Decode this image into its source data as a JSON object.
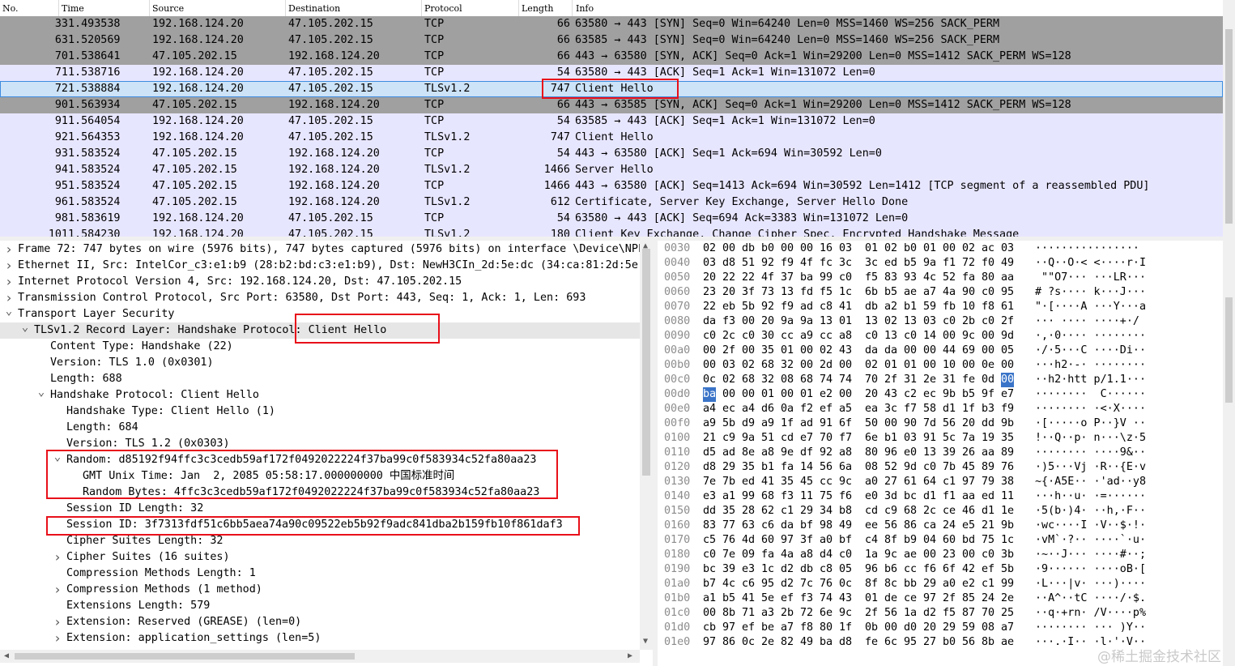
{
  "columns": {
    "no": "No.",
    "time": "Time",
    "source": "Source",
    "destination": "Destination",
    "protocol": "Protocol",
    "length": "Length",
    "info": "Info"
  },
  "packets": [
    {
      "no": "33",
      "time": "1.493538",
      "src": "192.168.124.20",
      "dst": "47.105.202.15",
      "proto": "TCP",
      "len": "66",
      "info": "63580 → 443 [SYN] Seq=0 Win=64240 Len=0 MSS=1460 WS=256 SACK_PERM",
      "bg": "#a0a0a0"
    },
    {
      "no": "63",
      "time": "1.520569",
      "src": "192.168.124.20",
      "dst": "47.105.202.15",
      "proto": "TCP",
      "len": "66",
      "info": "63585 → 443 [SYN] Seq=0 Win=64240 Len=0 MSS=1460 WS=256 SACK_PERM",
      "bg": "#a0a0a0"
    },
    {
      "no": "70",
      "time": "1.538641",
      "src": "47.105.202.15",
      "dst": "192.168.124.20",
      "proto": "TCP",
      "len": "66",
      "info": "443 → 63580 [SYN, ACK] Seq=0 Ack=1 Win=29200 Len=0 MSS=1412 SACK_PERM WS=128",
      "bg": "#a0a0a0"
    },
    {
      "no": "71",
      "time": "1.538716",
      "src": "192.168.124.20",
      "dst": "47.105.202.15",
      "proto": "TCP",
      "len": "54",
      "info": "63580 → 443 [ACK] Seq=1 Ack=1 Win=131072 Len=0",
      "bg": "#e7e6ff"
    },
    {
      "no": "72",
      "time": "1.538884",
      "src": "192.168.124.20",
      "dst": "47.105.202.15",
      "proto": "TLSv1.2",
      "len": "747",
      "info": "Client Hello",
      "bg": "#cde3f7",
      "selected": true
    },
    {
      "no": "90",
      "time": "1.563934",
      "src": "47.105.202.15",
      "dst": "192.168.124.20",
      "proto": "TCP",
      "len": "66",
      "info": "443 → 63585 [SYN, ACK] Seq=0 Ack=1 Win=29200 Len=0 MSS=1412 SACK_PERM WS=128",
      "bg": "#a0a0a0"
    },
    {
      "no": "91",
      "time": "1.564054",
      "src": "192.168.124.20",
      "dst": "47.105.202.15",
      "proto": "TCP",
      "len": "54",
      "info": "63585 → 443 [ACK] Seq=1 Ack=1 Win=131072 Len=0",
      "bg": "#e7e6ff"
    },
    {
      "no": "92",
      "time": "1.564353",
      "src": "192.168.124.20",
      "dst": "47.105.202.15",
      "proto": "TLSv1.2",
      "len": "747",
      "info": "Client Hello",
      "bg": "#e7e6ff"
    },
    {
      "no": "93",
      "time": "1.583524",
      "src": "47.105.202.15",
      "dst": "192.168.124.20",
      "proto": "TCP",
      "len": "54",
      "info": "443 → 63580 [ACK] Seq=1 Ack=694 Win=30592 Len=0",
      "bg": "#e7e6ff"
    },
    {
      "no": "94",
      "time": "1.583524",
      "src": "47.105.202.15",
      "dst": "192.168.124.20",
      "proto": "TLSv1.2",
      "len": "1466",
      "info": "Server Hello",
      "bg": "#e7e6ff"
    },
    {
      "no": "95",
      "time": "1.583524",
      "src": "47.105.202.15",
      "dst": "192.168.124.20",
      "proto": "TCP",
      "len": "1466",
      "info": "443 → 63580 [ACK] Seq=1413 Ack=694 Win=30592 Len=1412 [TCP segment of a reassembled PDU]",
      "bg": "#e7e6ff"
    },
    {
      "no": "96",
      "time": "1.583524",
      "src": "47.105.202.15",
      "dst": "192.168.124.20",
      "proto": "TLSv1.2",
      "len": "612",
      "info": "Certificate, Server Key Exchange, Server Hello Done",
      "bg": "#e7e6ff"
    },
    {
      "no": "98",
      "time": "1.583619",
      "src": "192.168.124.20",
      "dst": "47.105.202.15",
      "proto": "TCP",
      "len": "54",
      "info": "63580 → 443 [ACK] Seq=694 Ack=3383 Win=131072 Len=0",
      "bg": "#e7e6ff"
    },
    {
      "no": "101",
      "time": "1.584230",
      "src": "192.168.124.20",
      "dst": "47.105.202.15",
      "proto": "TLSv1.2",
      "len": "180",
      "info": "Client Key Exchange, Change Cipher Spec, Encrypted Handshake Message",
      "bg": "#e7e6ff"
    }
  ],
  "details": [
    {
      "indent": 0,
      "arrow": ">",
      "text": "Frame 72: 747 bytes on wire (5976 bits), 747 bytes captured (5976 bits) on interface \\Device\\NPF"
    },
    {
      "indent": 0,
      "arrow": ">",
      "text": "Ethernet II, Src: IntelCor_c3:e1:b9 (28:b2:bd:c3:e1:b9), Dst: NewH3CIn_2d:5e:dc (34:ca:81:2d:5e:"
    },
    {
      "indent": 0,
      "arrow": ">",
      "text": "Internet Protocol Version 4, Src: 192.168.124.20, Dst: 47.105.202.15"
    },
    {
      "indent": 0,
      "arrow": ">",
      "text": "Transmission Control Protocol, Src Port: 63580, Dst Port: 443, Seq: 1, Ack: 1, Len: 693"
    },
    {
      "indent": 0,
      "arrow": "v",
      "text": "Transport Layer Security"
    },
    {
      "indent": 1,
      "arrow": "v",
      "text": "TLSv1.2 Record Layer: Handshake Protocol: Client Hello",
      "selected": true
    },
    {
      "indent": 2,
      "arrow": "",
      "text": "Content Type: Handshake (22)"
    },
    {
      "indent": 2,
      "arrow": "",
      "text": "Version: TLS 1.0 (0x0301)"
    },
    {
      "indent": 2,
      "arrow": "",
      "text": "Length: 688"
    },
    {
      "indent": 2,
      "arrow": "v",
      "text": "Handshake Protocol: Client Hello"
    },
    {
      "indent": 3,
      "arrow": "",
      "text": "Handshake Type: Client Hello (1)"
    },
    {
      "indent": 3,
      "arrow": "",
      "text": "Length: 684"
    },
    {
      "indent": 3,
      "arrow": "",
      "text": "Version: TLS 1.2 (0x0303)"
    },
    {
      "indent": 3,
      "arrow": "v",
      "text": "Random: d85192f94ffc3c3cedb59af172f0492022224f37ba99c0f583934c52fa80aa23"
    },
    {
      "indent": 4,
      "arrow": "",
      "text": "GMT Unix Time: Jan  2, 2085 05:58:17.000000000 中国标准时间"
    },
    {
      "indent": 4,
      "arrow": "",
      "text": "Random Bytes: 4ffc3c3cedb59af172f0492022224f37ba99c0f583934c52fa80aa23"
    },
    {
      "indent": 3,
      "arrow": "",
      "text": "Session ID Length: 32"
    },
    {
      "indent": 3,
      "arrow": "",
      "text": "Session ID: 3f7313fdf51c6bb5aea74a90c09522eb5b92f9adc841dba2b159fb10f861daf3"
    },
    {
      "indent": 3,
      "arrow": "",
      "text": "Cipher Suites Length: 32"
    },
    {
      "indent": 3,
      "arrow": ">",
      "text": "Cipher Suites (16 suites)"
    },
    {
      "indent": 3,
      "arrow": "",
      "text": "Compression Methods Length: 1"
    },
    {
      "indent": 3,
      "arrow": ">",
      "text": "Compression Methods (1 method)"
    },
    {
      "indent": 3,
      "arrow": "",
      "text": "Extensions Length: 579"
    },
    {
      "indent": 3,
      "arrow": ">",
      "text": "Extension: Reserved (GREASE) (len=0)"
    },
    {
      "indent": 3,
      "arrow": ">",
      "text": "Extension: application_settings (len=5)"
    }
  ],
  "bytes": [
    {
      "off": "0030",
      "hex": [
        "02",
        "00",
        "db",
        "b0",
        "00",
        "00",
        "16",
        "03",
        "01",
        "02",
        "b0",
        "01",
        "00",
        "02",
        "ac",
        "03"
      ],
      "ascii": "················"
    },
    {
      "off": "0040",
      "hex": [
        "03",
        "d8",
        "51",
        "92",
        "f9",
        "4f",
        "fc",
        "3c",
        "3c",
        "ed",
        "b5",
        "9a",
        "f1",
        "72",
        "f0",
        "49"
      ],
      "ascii": "··Q··O·< <····r·I"
    },
    {
      "off": "0050",
      "hex": [
        "20",
        "22",
        "22",
        "4f",
        "37",
        "ba",
        "99",
        "c0",
        "f5",
        "83",
        "93",
        "4c",
        "52",
        "fa",
        "80",
        "aa"
      ],
      "ascii": " \"\"O7··· ···LR···"
    },
    {
      "off": "0060",
      "hex": [
        "23",
        "20",
        "3f",
        "73",
        "13",
        "fd",
        "f5",
        "1c",
        "6b",
        "b5",
        "ae",
        "a7",
        "4a",
        "90",
        "c0",
        "95"
      ],
      "ascii": "# ?s···· k···J···"
    },
    {
      "off": "0070",
      "hex": [
        "22",
        "eb",
        "5b",
        "92",
        "f9",
        "ad",
        "c8",
        "41",
        "db",
        "a2",
        "b1",
        "59",
        "fb",
        "10",
        "f8",
        "61"
      ],
      "ascii": "\"·[····A ···Y···a"
    },
    {
      "off": "0080",
      "hex": [
        "da",
        "f3",
        "00",
        "20",
        "9a",
        "9a",
        "13",
        "01",
        "13",
        "02",
        "13",
        "03",
        "c0",
        "2b",
        "c0",
        "2f"
      ],
      "ascii": "··· ···· ····+·/"
    },
    {
      "off": "0090",
      "hex": [
        "c0",
        "2c",
        "c0",
        "30",
        "cc",
        "a9",
        "cc",
        "a8",
        "c0",
        "13",
        "c0",
        "14",
        "00",
        "9c",
        "00",
        "9d"
      ],
      "ascii": "·,·0···· ········"
    },
    {
      "off": "00a0",
      "hex": [
        "00",
        "2f",
        "00",
        "35",
        "01",
        "00",
        "02",
        "43",
        "da",
        "da",
        "00",
        "00",
        "44",
        "69",
        "00",
        "05"
      ],
      "ascii": "·/·5···C ····Di··"
    },
    {
      "off": "00b0",
      "hex": [
        "00",
        "03",
        "02",
        "68",
        "32",
        "00",
        "2d",
        "00",
        "02",
        "01",
        "01",
        "00",
        "10",
        "00",
        "0e",
        "00"
      ],
      "ascii": "···h2·-· ········"
    },
    {
      "off": "00c0",
      "hex": [
        "0c",
        "02",
        "68",
        "32",
        "08",
        "68",
        "74",
        "74",
        "70",
        "2f",
        "31",
        "2e",
        "31",
        "fe",
        "0d",
        "00"
      ],
      "ascii": "··h2·htt p/1.1···",
      "hl": [
        15
      ]
    },
    {
      "off": "00d0",
      "hex": [
        "ba",
        "00",
        "00",
        "01",
        "00",
        "01",
        "e2",
        "00",
        "20",
        "43",
        "c2",
        "ec",
        "9b",
        "b5",
        "9f",
        "e7"
      ],
      "ascii": "········  C······",
      "hl": [
        0
      ]
    },
    {
      "off": "00e0",
      "hex": [
        "a4",
        "ec",
        "a4",
        "d6",
        "0a",
        "f2",
        "ef",
        "a5",
        "ea",
        "3c",
        "f7",
        "58",
        "d1",
        "1f",
        "b3",
        "f9"
      ],
      "ascii": "········ ·<·X····"
    },
    {
      "off": "00f0",
      "hex": [
        "a9",
        "5b",
        "d9",
        "a9",
        "1f",
        "ad",
        "91",
        "6f",
        "50",
        "00",
        "90",
        "7d",
        "56",
        "20",
        "dd",
        "9b"
      ],
      "ascii": "·[·····o P··}V ··"
    },
    {
      "off": "0100",
      "hex": [
        "21",
        "c9",
        "9a",
        "51",
        "cd",
        "e7",
        "70",
        "f7",
        "6e",
        "b1",
        "03",
        "91",
        "5c",
        "7a",
        "19",
        "35"
      ],
      "ascii": "!··Q··p· n···\\z·5"
    },
    {
      "off": "0110",
      "hex": [
        "d5",
        "ad",
        "8e",
        "a8",
        "9e",
        "df",
        "92",
        "a8",
        "80",
        "96",
        "e0",
        "13",
        "39",
        "26",
        "aa",
        "89"
      ],
      "ascii": "········ ····9&··"
    },
    {
      "off": "0120",
      "hex": [
        "d8",
        "29",
        "35",
        "b1",
        "fa",
        "14",
        "56",
        "6a",
        "08",
        "52",
        "9d",
        "c0",
        "7b",
        "45",
        "89",
        "76"
      ],
      "ascii": "·)5···Vj ·R··{E·v"
    },
    {
      "off": "0130",
      "hex": [
        "7e",
        "7b",
        "ed",
        "41",
        "35",
        "45",
        "cc",
        "9c",
        "a0",
        "27",
        "61",
        "64",
        "c1",
        "97",
        "79",
        "38"
      ],
      "ascii": "~{·A5E·· ·'ad··y8"
    },
    {
      "off": "0140",
      "hex": [
        "e3",
        "a1",
        "99",
        "68",
        "f3",
        "11",
        "75",
        "f6",
        "e0",
        "3d",
        "bc",
        "d1",
        "f1",
        "aa",
        "ed",
        "11"
      ],
      "ascii": "···h··u· ·=······"
    },
    {
      "off": "0150",
      "hex": [
        "dd",
        "35",
        "28",
        "62",
        "c1",
        "29",
        "34",
        "b8",
        "cd",
        "c9",
        "68",
        "2c",
        "ce",
        "46",
        "d1",
        "1e"
      ],
      "ascii": "·5(b·)4· ··h,·F··"
    },
    {
      "off": "0160",
      "hex": [
        "83",
        "77",
        "63",
        "c6",
        "da",
        "bf",
        "98",
        "49",
        "ee",
        "56",
        "86",
        "ca",
        "24",
        "e5",
        "21",
        "9b"
      ],
      "ascii": "·wc····I ·V··$·!·"
    },
    {
      "off": "0170",
      "hex": [
        "c5",
        "76",
        "4d",
        "60",
        "97",
        "3f",
        "a0",
        "bf",
        "c4",
        "8f",
        "b9",
        "04",
        "60",
        "bd",
        "75",
        "1c"
      ],
      "ascii": "·vM`·?·· ····`·u·"
    },
    {
      "off": "0180",
      "hex": [
        "c0",
        "7e",
        "09",
        "fa",
        "4a",
        "a8",
        "d4",
        "c0",
        "1a",
        "9c",
        "ae",
        "00",
        "23",
        "00",
        "c0",
        "3b"
      ],
      "ascii": "·~··J··· ····#··;"
    },
    {
      "off": "0190",
      "hex": [
        "bc",
        "39",
        "e3",
        "1c",
        "d2",
        "db",
        "c8",
        "05",
        "96",
        "b6",
        "cc",
        "f6",
        "6f",
        "42",
        "ef",
        "5b"
      ],
      "ascii": "·9······ ····oB·["
    },
    {
      "off": "01a0",
      "hex": [
        "b7",
        "4c",
        "c6",
        "95",
        "d2",
        "7c",
        "76",
        "0c",
        "8f",
        "8c",
        "bb",
        "29",
        "a0",
        "e2",
        "c1",
        "99"
      ],
      "ascii": "·L···|v· ···)····"
    },
    {
      "off": "01b0",
      "hex": [
        "a1",
        "b5",
        "41",
        "5e",
        "ef",
        "f3",
        "74",
        "43",
        "01",
        "de",
        "ce",
        "97",
        "2f",
        "85",
        "24",
        "2e"
      ],
      "ascii": "··A^··tC ····/·$."
    },
    {
      "off": "01c0",
      "hex": [
        "00",
        "8b",
        "71",
        "a3",
        "2b",
        "72",
        "6e",
        "9c",
        "2f",
        "56",
        "1a",
        "d2",
        "f5",
        "87",
        "70",
        "25"
      ],
      "ascii": "··q·+rn· /V····p%"
    },
    {
      "off": "01d0",
      "hex": [
        "cb",
        "97",
        "ef",
        "be",
        "a7",
        "f8",
        "80",
        "1f",
        "0b",
        "00",
        "d0",
        "20",
        "29",
        "59",
        "08",
        "a7"
      ],
      "ascii": "········ ··· )Y··"
    },
    {
      "off": "01e0",
      "hex": [
        "97",
        "86",
        "0c",
        "2e",
        "82",
        "49",
        "ba",
        "d8",
        "fe",
        "6c",
        "95",
        "27",
        "b0",
        "56",
        "8b",
        "ae"
      ],
      "ascii": "···.·I·· ·l·'·V··"
    }
  ],
  "watermark": "@稀土掘金技术社区",
  "colors": {
    "highlight_border": "#e8101a",
    "selected_bytes": "#3a74c8",
    "tcp_syn": "#a0a0a0",
    "tcp_tls": "#e7e6ff",
    "selected_row": "#cde3f7"
  }
}
